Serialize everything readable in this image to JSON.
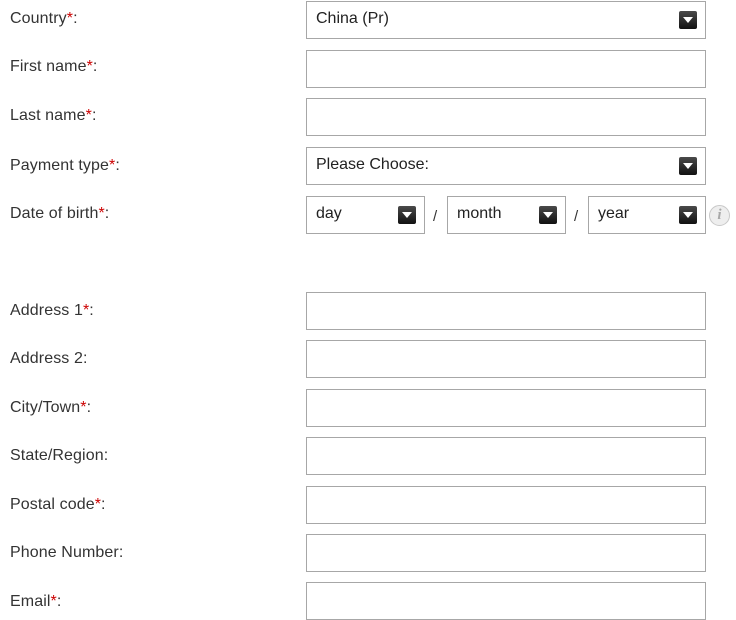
{
  "form": {
    "country": {
      "label": "Country",
      "required": "*",
      "suffix": ":",
      "value": "China (Pr)"
    },
    "first_name": {
      "label": "First name",
      "required": "*",
      "suffix": ":",
      "value": ""
    },
    "last_name": {
      "label": "Last name",
      "required": "*",
      "suffix": ":",
      "value": ""
    },
    "payment_type": {
      "label": "Payment type",
      "required": "*",
      "suffix": ":",
      "value": "Please Choose:"
    },
    "date_of_birth": {
      "label": "Date of birth",
      "required": "*",
      "suffix": ":",
      "day": "day",
      "month": "month",
      "year": "year",
      "separator": "/"
    },
    "address1": {
      "label": "Address 1",
      "required": "*",
      "suffix": ":",
      "value": ""
    },
    "address2": {
      "label": "Address 2:",
      "value": ""
    },
    "city": {
      "label": "City/Town",
      "required": "*",
      "suffix": ":",
      "value": ""
    },
    "state": {
      "label": "State/Region:",
      "value": ""
    },
    "postal_code": {
      "label": "Postal code",
      "required": "*",
      "suffix": ":",
      "value": ""
    },
    "phone": {
      "label": "Phone Number:",
      "value": ""
    },
    "email": {
      "label": "Email",
      "required": "*",
      "suffix": ":",
      "value": ""
    }
  },
  "icons": {
    "info": "info-icon",
    "info_glyph": "i",
    "dropdown": "chevron-down-icon"
  },
  "colors": {
    "required_star": "#cc0000",
    "border": "#a7a7a7",
    "text": "#333333"
  }
}
